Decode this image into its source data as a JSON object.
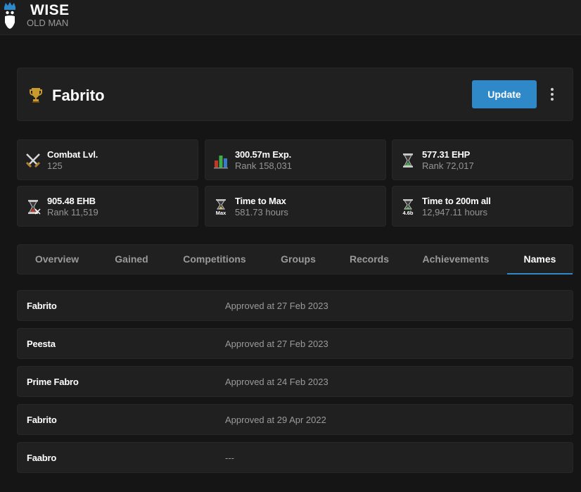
{
  "brand": {
    "title": "WISE",
    "subtitle": "OLD MAN"
  },
  "player": {
    "name": "Fabrito",
    "update_label": "Update"
  },
  "stats": [
    {
      "title": "Combat Lvl.",
      "sub": "125",
      "icon": "crossed-swords-icon"
    },
    {
      "title": "300.57m Exp.",
      "sub": "Rank 158,031",
      "icon": "bar-chart-icon"
    },
    {
      "title": "577.31 EHP",
      "sub": "Rank 72,017",
      "icon": "hourglass-icon"
    },
    {
      "title": "905.48 EHB",
      "sub": "Rank 11,519",
      "icon": "hourglass-boss-icon"
    },
    {
      "title": "Time to Max",
      "sub": "581.73 hours",
      "icon": "hourglass-max-icon",
      "badge": "Max"
    },
    {
      "title": "Time to 200m all",
      "sub": "12,947.11 hours",
      "icon": "hourglass-200m-icon",
      "badge": "4.6b"
    }
  ],
  "tabs": [
    {
      "label": "Overview"
    },
    {
      "label": "Gained"
    },
    {
      "label": "Competitions"
    },
    {
      "label": "Groups"
    },
    {
      "label": "Records"
    },
    {
      "label": "Achievements"
    },
    {
      "label": "Names",
      "active": true
    }
  ],
  "names": [
    {
      "name": "Fabrito",
      "status": "Approved at 27 Feb 2023"
    },
    {
      "name": "Peesta",
      "status": "Approved at 27 Feb 2023"
    },
    {
      "name": "Prime Fabro",
      "status": "Approved at 24 Feb 2023"
    },
    {
      "name": "Fabrito",
      "status": "Approved at 29 Apr 2022"
    },
    {
      "name": "Faabro",
      "status": "---"
    }
  ],
  "colors": {
    "accent": "#2f88c8",
    "background": "#151515",
    "card": "#202020",
    "muted": "#9a9a9a"
  }
}
